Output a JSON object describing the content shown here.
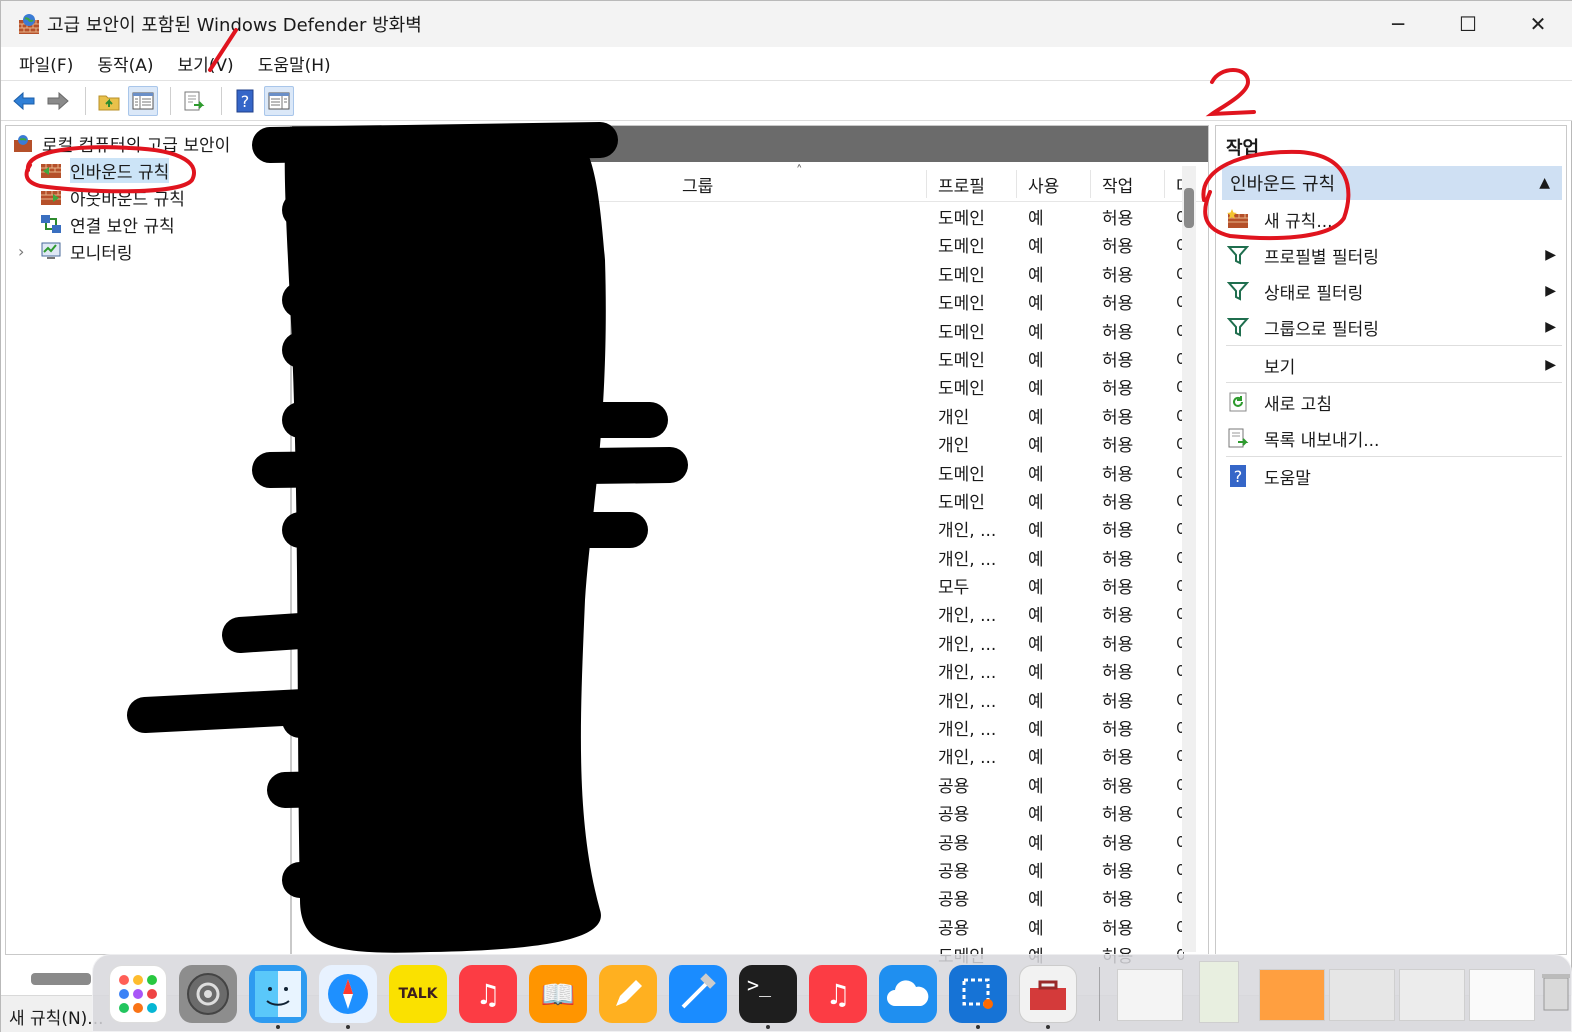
{
  "window": {
    "title": "고급 보안이 포함된 Windows Defender 방화벽",
    "controls": {
      "minimize": "─",
      "maximize": "☐",
      "close": "✕"
    }
  },
  "menu": [
    "파일(F)",
    "동작(A)",
    "보기(V)",
    "도움말(H)"
  ],
  "tree": {
    "root": "로컬 컴퓨터의 고급 보안이",
    "items": [
      "인바운드 규칙",
      "아웃바운드 규칙",
      "연결 보안 규칙",
      "모니터링"
    ],
    "expander": "›"
  },
  "list": {
    "columns": {
      "group": "그룹",
      "profile": "프로필",
      "enabled": "사용",
      "action": "작업",
      "override": "다"
    },
    "sort_indicator": "˄",
    "rows": [
      {
        "profile": "도메인",
        "enabled": "예",
        "action": "허용",
        "override": "아"
      },
      {
        "profile": "도메인",
        "enabled": "예",
        "action": "허용",
        "override": "아"
      },
      {
        "profile": "도메인",
        "enabled": "예",
        "action": "허용",
        "override": "아"
      },
      {
        "profile": "도메인",
        "enabled": "예",
        "action": "허용",
        "override": "아"
      },
      {
        "profile": "도메인",
        "enabled": "예",
        "action": "허용",
        "override": "아"
      },
      {
        "profile": "도메인",
        "enabled": "예",
        "action": "허용",
        "override": "아"
      },
      {
        "profile": "도메인",
        "enabled": "예",
        "action": "허용",
        "override": "아"
      },
      {
        "profile": "개인",
        "enabled": "예",
        "action": "허용",
        "override": "아"
      },
      {
        "profile": "개인",
        "enabled": "예",
        "action": "허용",
        "override": "아"
      },
      {
        "profile": "도메인",
        "enabled": "예",
        "action": "허용",
        "override": "아"
      },
      {
        "profile": "도메인",
        "enabled": "예",
        "action": "허용",
        "override": "아"
      },
      {
        "profile": "개인, ...",
        "enabled": "예",
        "action": "허용",
        "override": "아"
      },
      {
        "profile": "개인, ...",
        "enabled": "예",
        "action": "허용",
        "override": "아"
      },
      {
        "profile": "모두",
        "enabled": "예",
        "action": "허용",
        "override": "아"
      },
      {
        "profile": "개인, ...",
        "enabled": "예",
        "action": "허용",
        "override": "아"
      },
      {
        "profile": "개인, ...",
        "enabled": "예",
        "action": "허용",
        "override": "아"
      },
      {
        "profile": "개인, ...",
        "enabled": "예",
        "action": "허용",
        "override": "아"
      },
      {
        "profile": "개인, ...",
        "enabled": "예",
        "action": "허용",
        "override": "아"
      },
      {
        "profile": "개인, ...",
        "enabled": "예",
        "action": "허용",
        "override": "아"
      },
      {
        "profile": "개인, ...",
        "enabled": "예",
        "action": "허용",
        "override": "아"
      },
      {
        "profile": "공용",
        "enabled": "예",
        "action": "허용",
        "override": "아"
      },
      {
        "profile": "공용",
        "enabled": "예",
        "action": "허용",
        "override": "아"
      },
      {
        "profile": "공용",
        "enabled": "예",
        "action": "허용",
        "override": "아"
      },
      {
        "profile": "공용",
        "enabled": "예",
        "action": "허용",
        "override": "아"
      },
      {
        "profile": "공용",
        "enabled": "예",
        "action": "허용",
        "override": "아"
      },
      {
        "profile": "공용",
        "enabled": "예",
        "action": "허용",
        "override": "아"
      },
      {
        "profile": "도메인",
        "enabled": "예",
        "action": "허용",
        "override": "아"
      }
    ]
  },
  "actions": {
    "title": "작업",
    "section": "인바운드 규칙",
    "section_arrow": "▲",
    "submenu_arrow": "▶",
    "items": [
      "새 규칙...",
      "프로필별 필터링",
      "상태로 필터링",
      "그룹으로 필터링",
      "보기",
      "새로 고침",
      "목록 내보내기...",
      "도움말"
    ]
  },
  "status": {
    "text": "새 규칙(N)..."
  },
  "annotations": {
    "one": "1",
    "two": "2"
  },
  "dock": {
    "glyphs": {
      "music": "♫",
      "books": "📖",
      "terminal": ">_",
      "kakao": "TALK"
    }
  },
  "colors": {
    "annotation_red": "#e0141e",
    "selection": "#cce4f7",
    "action_section": "#cfe0f3",
    "header_bar": "#6b6b6b"
  }
}
